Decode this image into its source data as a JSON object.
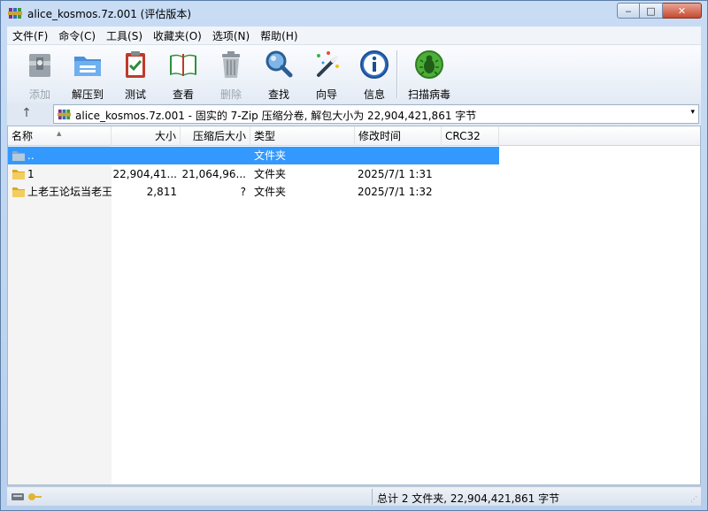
{
  "window": {
    "title": "alice_kosmos.7z.001 (评估版本)",
    "minimize": "‒",
    "maximize": "□",
    "close": "✕"
  },
  "menu": [
    {
      "label": "文件(F)"
    },
    {
      "label": "命令(C)"
    },
    {
      "label": "工具(S)"
    },
    {
      "label": "收藏夹(O)"
    },
    {
      "label": "选项(N)"
    },
    {
      "label": "帮助(H)"
    }
  ],
  "toolbar": {
    "add": "添加",
    "extract": "解压到",
    "test": "测试",
    "view": "查看",
    "delete": "删除",
    "find": "查找",
    "wizard": "向导",
    "info": "信息",
    "scan": "扫描病毒"
  },
  "address": {
    "up_glyph": "↑",
    "path": "alice_kosmos.7z.001 - 固实的 7-Zip 压缩分卷, 解包大小为 22,904,421,861 字节",
    "dropdown_glyph": "▾"
  },
  "columns": {
    "name": "名称",
    "size": "大小",
    "packed": "压缩后大小",
    "type": "类型",
    "modified": "修改时间",
    "crc": "CRC32"
  },
  "rows": [
    {
      "name": "..",
      "size": "",
      "packed": "",
      "type": "文件夹",
      "modified": "",
      "crc": "",
      "icon": "up-folder-icon",
      "selected": true
    },
    {
      "name": "1",
      "size": "22,904,41...",
      "packed": "21,064,96...",
      "type": "文件夹",
      "modified": "2025/7/1 1:31",
      "crc": "",
      "icon": "folder-icon",
      "selected": false
    },
    {
      "name": "上老王论坛当老王",
      "size": "2,811",
      "packed": "?",
      "type": "文件夹",
      "modified": "2025/7/1 1:32",
      "crc": "",
      "icon": "folder-icon",
      "selected": false
    }
  ],
  "status": {
    "summary": "总计 2 文件夹, 22,904,421,861 字节"
  },
  "colors": {
    "selection": "#3399ff",
    "frame": "#bcd3ee"
  }
}
